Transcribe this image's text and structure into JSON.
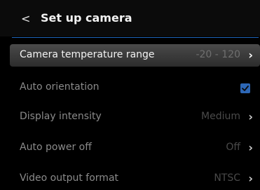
{
  "header": {
    "back_glyph": "<",
    "title": "Set up camera"
  },
  "menu": {
    "items": [
      {
        "label": "Camera temperature range",
        "value": "-20 - 120",
        "selected": true,
        "icon": "chevron-right-icon"
      },
      {
        "label": "Auto orientation",
        "checked": true,
        "icon": "checkbox-checked-icon"
      },
      {
        "label": "Display intensity",
        "value": "Medium",
        "icon": "chevron-right-icon"
      },
      {
        "label": "Auto power off",
        "value": "Off",
        "icon": "chevron-right-icon"
      },
      {
        "label": "Video output format",
        "value": "NTSC",
        "icon": "chevron-right-icon"
      }
    ]
  },
  "colors": {
    "accent": "#1e63b8",
    "checkbox": "#2d67b6"
  }
}
